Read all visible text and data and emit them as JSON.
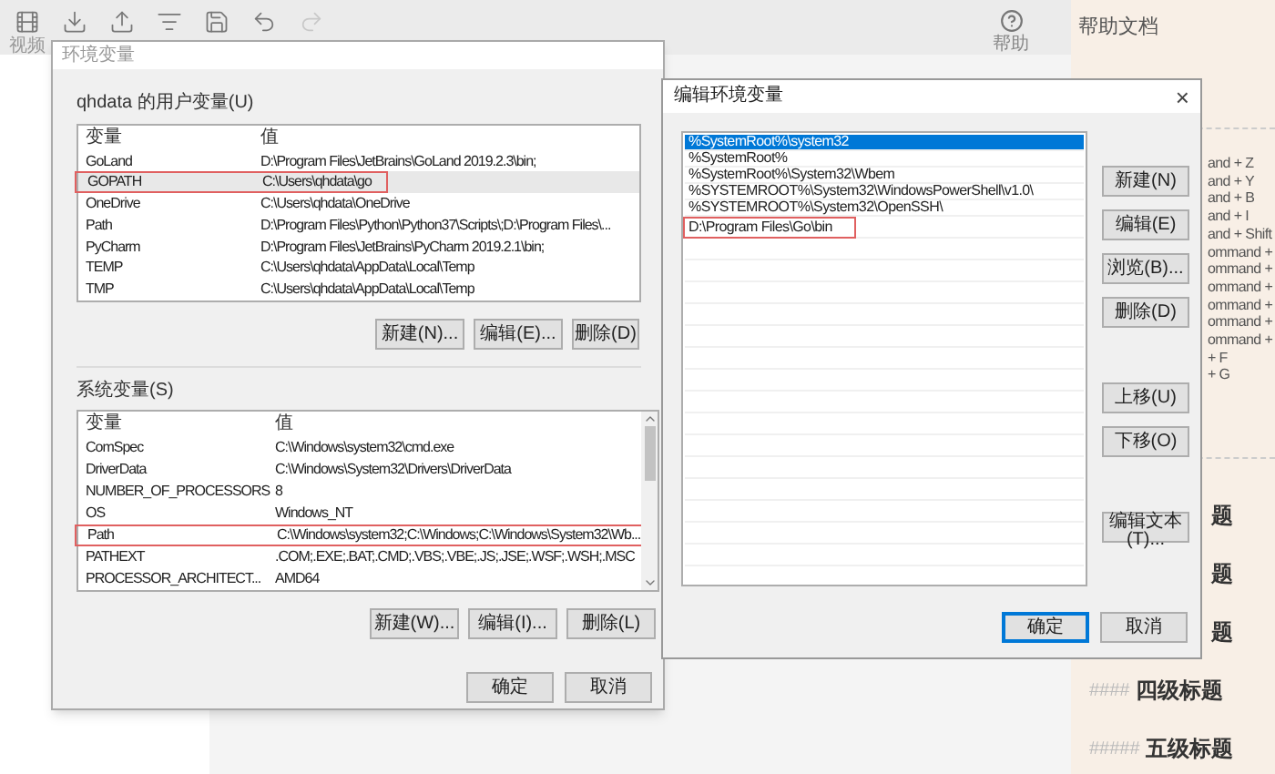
{
  "toolbar": {
    "tools": [
      {
        "kind": "video",
        "label": "视频",
        "disabled": false
      },
      {
        "kind": "download",
        "disabled": false
      },
      {
        "kind": "upload",
        "disabled": false
      },
      {
        "kind": "list",
        "disabled": false
      },
      {
        "kind": "save",
        "disabled": false
      },
      {
        "kind": "undo",
        "disabled": false
      },
      {
        "kind": "redo",
        "disabled": true
      }
    ],
    "help": {
      "label": "帮助"
    }
  },
  "help_panel": {
    "title": "帮助文档",
    "shortcuts": [
      "and + Z",
      "and + Y",
      "and + B",
      "and + I",
      "and + Shift",
      "ommand +",
      "ommand +",
      "ommand +",
      "ommand +",
      "ommand +",
      "ommand +",
      "+ F",
      "+ G"
    ],
    "headings": [
      {
        "text": "题"
      },
      {
        "text": "题"
      },
      {
        "text": "题"
      },
      {
        "marks": "####",
        "text": "四级标题"
      },
      {
        "marks": "#####",
        "text": "五级标题"
      }
    ]
  },
  "env_dialog": {
    "title": "环境变量",
    "user_group": {
      "label": "qhdata 的用户变量(U)",
      "columns": [
        "变量",
        "值"
      ],
      "rows": [
        {
          "name": "GoLand",
          "value": "D:\\Program Files\\JetBrains\\GoLand 2019.2.3\\bin;",
          "selected": false,
          "marked": false
        },
        {
          "name": "GOPATH",
          "value": "C:\\Users\\qhdata\\go",
          "selected": true,
          "marked": true
        },
        {
          "name": "OneDrive",
          "value": "C:\\Users\\qhdata\\OneDrive",
          "selected": false,
          "marked": false
        },
        {
          "name": "Path",
          "value": "D:\\Program Files\\Python\\Python37\\Scripts\\;D:\\Program Files\\...",
          "selected": false,
          "marked": false
        },
        {
          "name": "PyCharm",
          "value": "D:\\Program Files\\JetBrains\\PyCharm 2019.2.1\\bin;",
          "selected": false,
          "marked": false
        },
        {
          "name": "TEMP",
          "value": "C:\\Users\\qhdata\\AppData\\Local\\Temp",
          "selected": false,
          "marked": false
        },
        {
          "name": "TMP",
          "value": "C:\\Users\\qhdata\\AppData\\Local\\Temp",
          "selected": false,
          "marked": false
        }
      ],
      "buttons": [
        "新建(N)...",
        "编辑(E)...",
        "删除(D)"
      ]
    },
    "system_group": {
      "label": "系统变量(S)",
      "columns": [
        "变量",
        "值"
      ],
      "rows": [
        {
          "name": "ComSpec",
          "value": "C:\\Windows\\system32\\cmd.exe",
          "selected": false,
          "marked": false
        },
        {
          "name": "DriverData",
          "value": "C:\\Windows\\System32\\Drivers\\DriverData",
          "selected": false,
          "marked": false
        },
        {
          "name": "NUMBER_OF_PROCESSORS",
          "value": "8",
          "selected": false,
          "marked": false
        },
        {
          "name": "OS",
          "value": "Windows_NT",
          "selected": false,
          "marked": false
        },
        {
          "name": "Path",
          "value": "C:\\Windows\\system32;C:\\Windows;C:\\Windows\\System32\\Wb...",
          "selected": false,
          "marked": true
        },
        {
          "name": "PATHEXT",
          "value": ".COM;.EXE;.BAT;.CMD;.VBS;.VBE;.JS;.JSE;.WSF;.WSH;.MSC",
          "selected": false,
          "marked": false
        },
        {
          "name": "PROCESSOR_ARCHITECT...",
          "value": "AMD64",
          "selected": false,
          "marked": false
        }
      ],
      "buttons": [
        "新建(W)...",
        "编辑(I)...",
        "删除(L)"
      ]
    },
    "buttons": [
      {
        "label": "确定",
        "default": false
      },
      {
        "label": "取消",
        "default": false
      }
    ]
  },
  "edit_dialog": {
    "title": "编辑环境变量",
    "close": "×",
    "entries": [
      {
        "text": "%SystemRoot%\\system32",
        "selected": true,
        "marked": false
      },
      {
        "text": "%SystemRoot%",
        "selected": false,
        "marked": false
      },
      {
        "text": "%SystemRoot%\\System32\\Wbem",
        "selected": false,
        "marked": false
      },
      {
        "text": "%SYSTEMROOT%\\System32\\WindowsPowerShell\\v1.0\\",
        "selected": false,
        "marked": false
      },
      {
        "text": "%SYSTEMROOT%\\System32\\OpenSSH\\",
        "selected": false,
        "marked": false
      },
      {
        "text": "D:\\Program Files\\Go\\bin",
        "selected": false,
        "marked": true
      }
    ],
    "side_buttons": [
      [
        "新建(N)",
        "编辑(E)",
        "浏览(B)...",
        "删除(D)"
      ],
      [
        "上移(U)",
        "下移(O)"
      ],
      [
        "编辑文本(T)..."
      ]
    ],
    "buttons": [
      {
        "label": "确定",
        "default": true
      },
      {
        "label": "取消",
        "default": false
      }
    ]
  }
}
